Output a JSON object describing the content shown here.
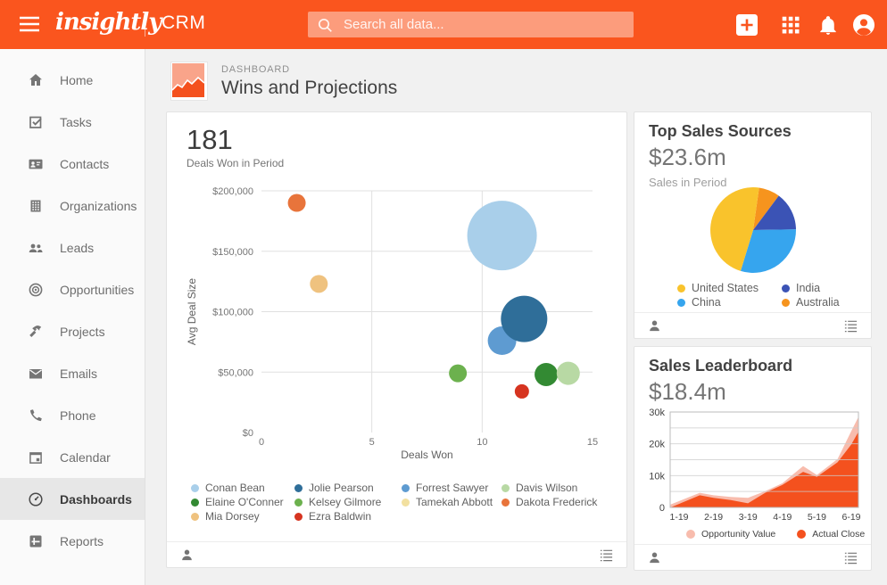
{
  "topbar": {
    "logo_text": "insightly",
    "product": "CRM",
    "search_placeholder": "Search all data..."
  },
  "sidebar": {
    "items": [
      {
        "label": "Home",
        "icon": "home-icon"
      },
      {
        "label": "Tasks",
        "icon": "tasks-icon"
      },
      {
        "label": "Contacts",
        "icon": "contact-card-icon"
      },
      {
        "label": "Organizations",
        "icon": "building-icon"
      },
      {
        "label": "Leads",
        "icon": "people-icon"
      },
      {
        "label": "Opportunities",
        "icon": "target-icon"
      },
      {
        "label": "Projects",
        "icon": "hammer-icon"
      },
      {
        "label": "Emails",
        "icon": "envelope-icon"
      },
      {
        "label": "Phone",
        "icon": "phone-icon"
      },
      {
        "label": "Calendar",
        "icon": "calendar-icon"
      },
      {
        "label": "Dashboards",
        "icon": "gauge-icon",
        "active": true
      },
      {
        "label": "Reports",
        "icon": "report-icon"
      }
    ]
  },
  "header": {
    "eyebrow": "DASHBOARD",
    "title": "Wins and Projections"
  },
  "chart_data": [
    {
      "type": "bubble",
      "value": "181",
      "subtitle": "Deals Won in Period",
      "xlabel": "Deals Won",
      "ylabel": "Avg Deal Size",
      "xlim": [
        0,
        15
      ],
      "ylim": [
        0,
        200000
      ],
      "grid": true,
      "xticks": [
        {
          "label": "0",
          "value": 0
        },
        {
          "label": "5",
          "value": 5
        },
        {
          "label": "10",
          "value": 10
        },
        {
          "label": "15",
          "value": 15
        }
      ],
      "yticks": [
        {
          "label": "$0",
          "value": 0
        },
        {
          "label": "$50,000",
          "value": 50000
        },
        {
          "label": "$100,000",
          "value": 100000
        },
        {
          "label": "$150,000",
          "value": 150000
        },
        {
          "label": "$200,000",
          "value": 200000
        }
      ],
      "series": [
        {
          "name": "Conan Bean",
          "color": "#A9CFEA"
        },
        {
          "name": "Jolie Pearson",
          "color": "#2F6E99"
        },
        {
          "name": "Forrest Sawyer",
          "color": "#5E9BD1"
        },
        {
          "name": "Davis Wilson",
          "color": "#B8D9A4"
        },
        {
          "name": "Elaine O'Conner",
          "color": "#338A33"
        },
        {
          "name": "Kelsey Gilmore",
          "color": "#6CB14E"
        },
        {
          "name": "Tamekah Abbott",
          "color": "#F2E0A0"
        },
        {
          "name": "Dakota Frederick",
          "color": "#E8743B"
        },
        {
          "name": "Mia Dorsey",
          "color": "#EFC27F"
        },
        {
          "name": "Ezra Baldwin",
          "color": "#D63420"
        }
      ],
      "points": [
        {
          "series": "Conan Bean",
          "x": 10.9,
          "y": 163000,
          "r": 39
        },
        {
          "series": "Dakota Frederick",
          "x": 1.6,
          "y": 190000,
          "r": 10
        },
        {
          "series": "Mia Dorsey",
          "x": 2.6,
          "y": 123000,
          "r": 10
        },
        {
          "series": "Kelsey Gilmore",
          "x": 8.9,
          "y": 49000,
          "r": 10
        },
        {
          "series": "Forrest Sawyer",
          "x": 10.9,
          "y": 76000,
          "r": 16
        },
        {
          "series": "Jolie Pearson",
          "x": 11.9,
          "y": 94000,
          "r": 26
        },
        {
          "series": "Elaine O'Conner",
          "x": 12.9,
          "y": 48000,
          "r": 13
        },
        {
          "series": "Davis Wilson",
          "x": 13.9,
          "y": 49000,
          "r": 13
        },
        {
          "series": "Ezra Baldwin",
          "x": 11.8,
          "y": 34000,
          "r": 8
        }
      ]
    },
    {
      "type": "pie",
      "title": "Top Sales Sources",
      "value": "$23.6m",
      "subtitle": "Sales in Period",
      "start_deg": 8,
      "slices": [
        {
          "label": "Australia",
          "pct": 8,
          "color": "#F6941E"
        },
        {
          "label": "India",
          "pct": 14.5,
          "color": "#3B53B5"
        },
        {
          "label": "China",
          "pct": 30,
          "color": "#36A5EE"
        },
        {
          "label": "United States",
          "pct": 47.5,
          "color": "#F9C32C"
        }
      ]
    },
    {
      "type": "area",
      "title": "Sales Leaderboard",
      "value": "$18.4m",
      "ylim": [
        0,
        30000
      ],
      "grid_step": 5000,
      "yticks": [
        {
          "label": "0",
          "value": 0
        },
        {
          "label": "10k",
          "value": 10000
        },
        {
          "label": "20k",
          "value": 20000
        },
        {
          "label": "30k",
          "value": 30000
        }
      ],
      "xticks": [
        "1-19",
        "2-19",
        "3-19",
        "4-19",
        "5-19",
        "6-19"
      ],
      "x": [
        -0.25,
        0.6,
        1,
        1.5,
        2,
        2.5,
        3,
        3.6,
        4,
        4.6,
        5,
        5.2
      ],
      "series": [
        {
          "name": "Opportunity Value",
          "color": "#F8BCAD",
          "values": [
            900,
            4600,
            3800,
            3300,
            3000,
            5100,
            7600,
            13000,
            10200,
            15200,
            24000,
            28300
          ]
        },
        {
          "name": "Actual Close",
          "color": "#F4511E",
          "values": [
            0,
            3800,
            3000,
            2300,
            1300,
            4600,
            7100,
            11200,
            9600,
            14200,
            19800,
            23600
          ]
        }
      ]
    }
  ],
  "icons": {
    "topbar": [
      "menu-icon",
      "search-icon",
      "add-icon",
      "apps-grid-icon",
      "notifications-bell-icon",
      "account-avatar-icon"
    ],
    "card_footer": [
      "owner-person-icon",
      "list-icon"
    ]
  },
  "colors": {
    "topbar_bg": "#FA551E",
    "accent": "#F4511E",
    "sidebar_bg": "#FAFAFA",
    "content_bg": "#F1F1F1",
    "card_border": "#E3E3E3"
  }
}
